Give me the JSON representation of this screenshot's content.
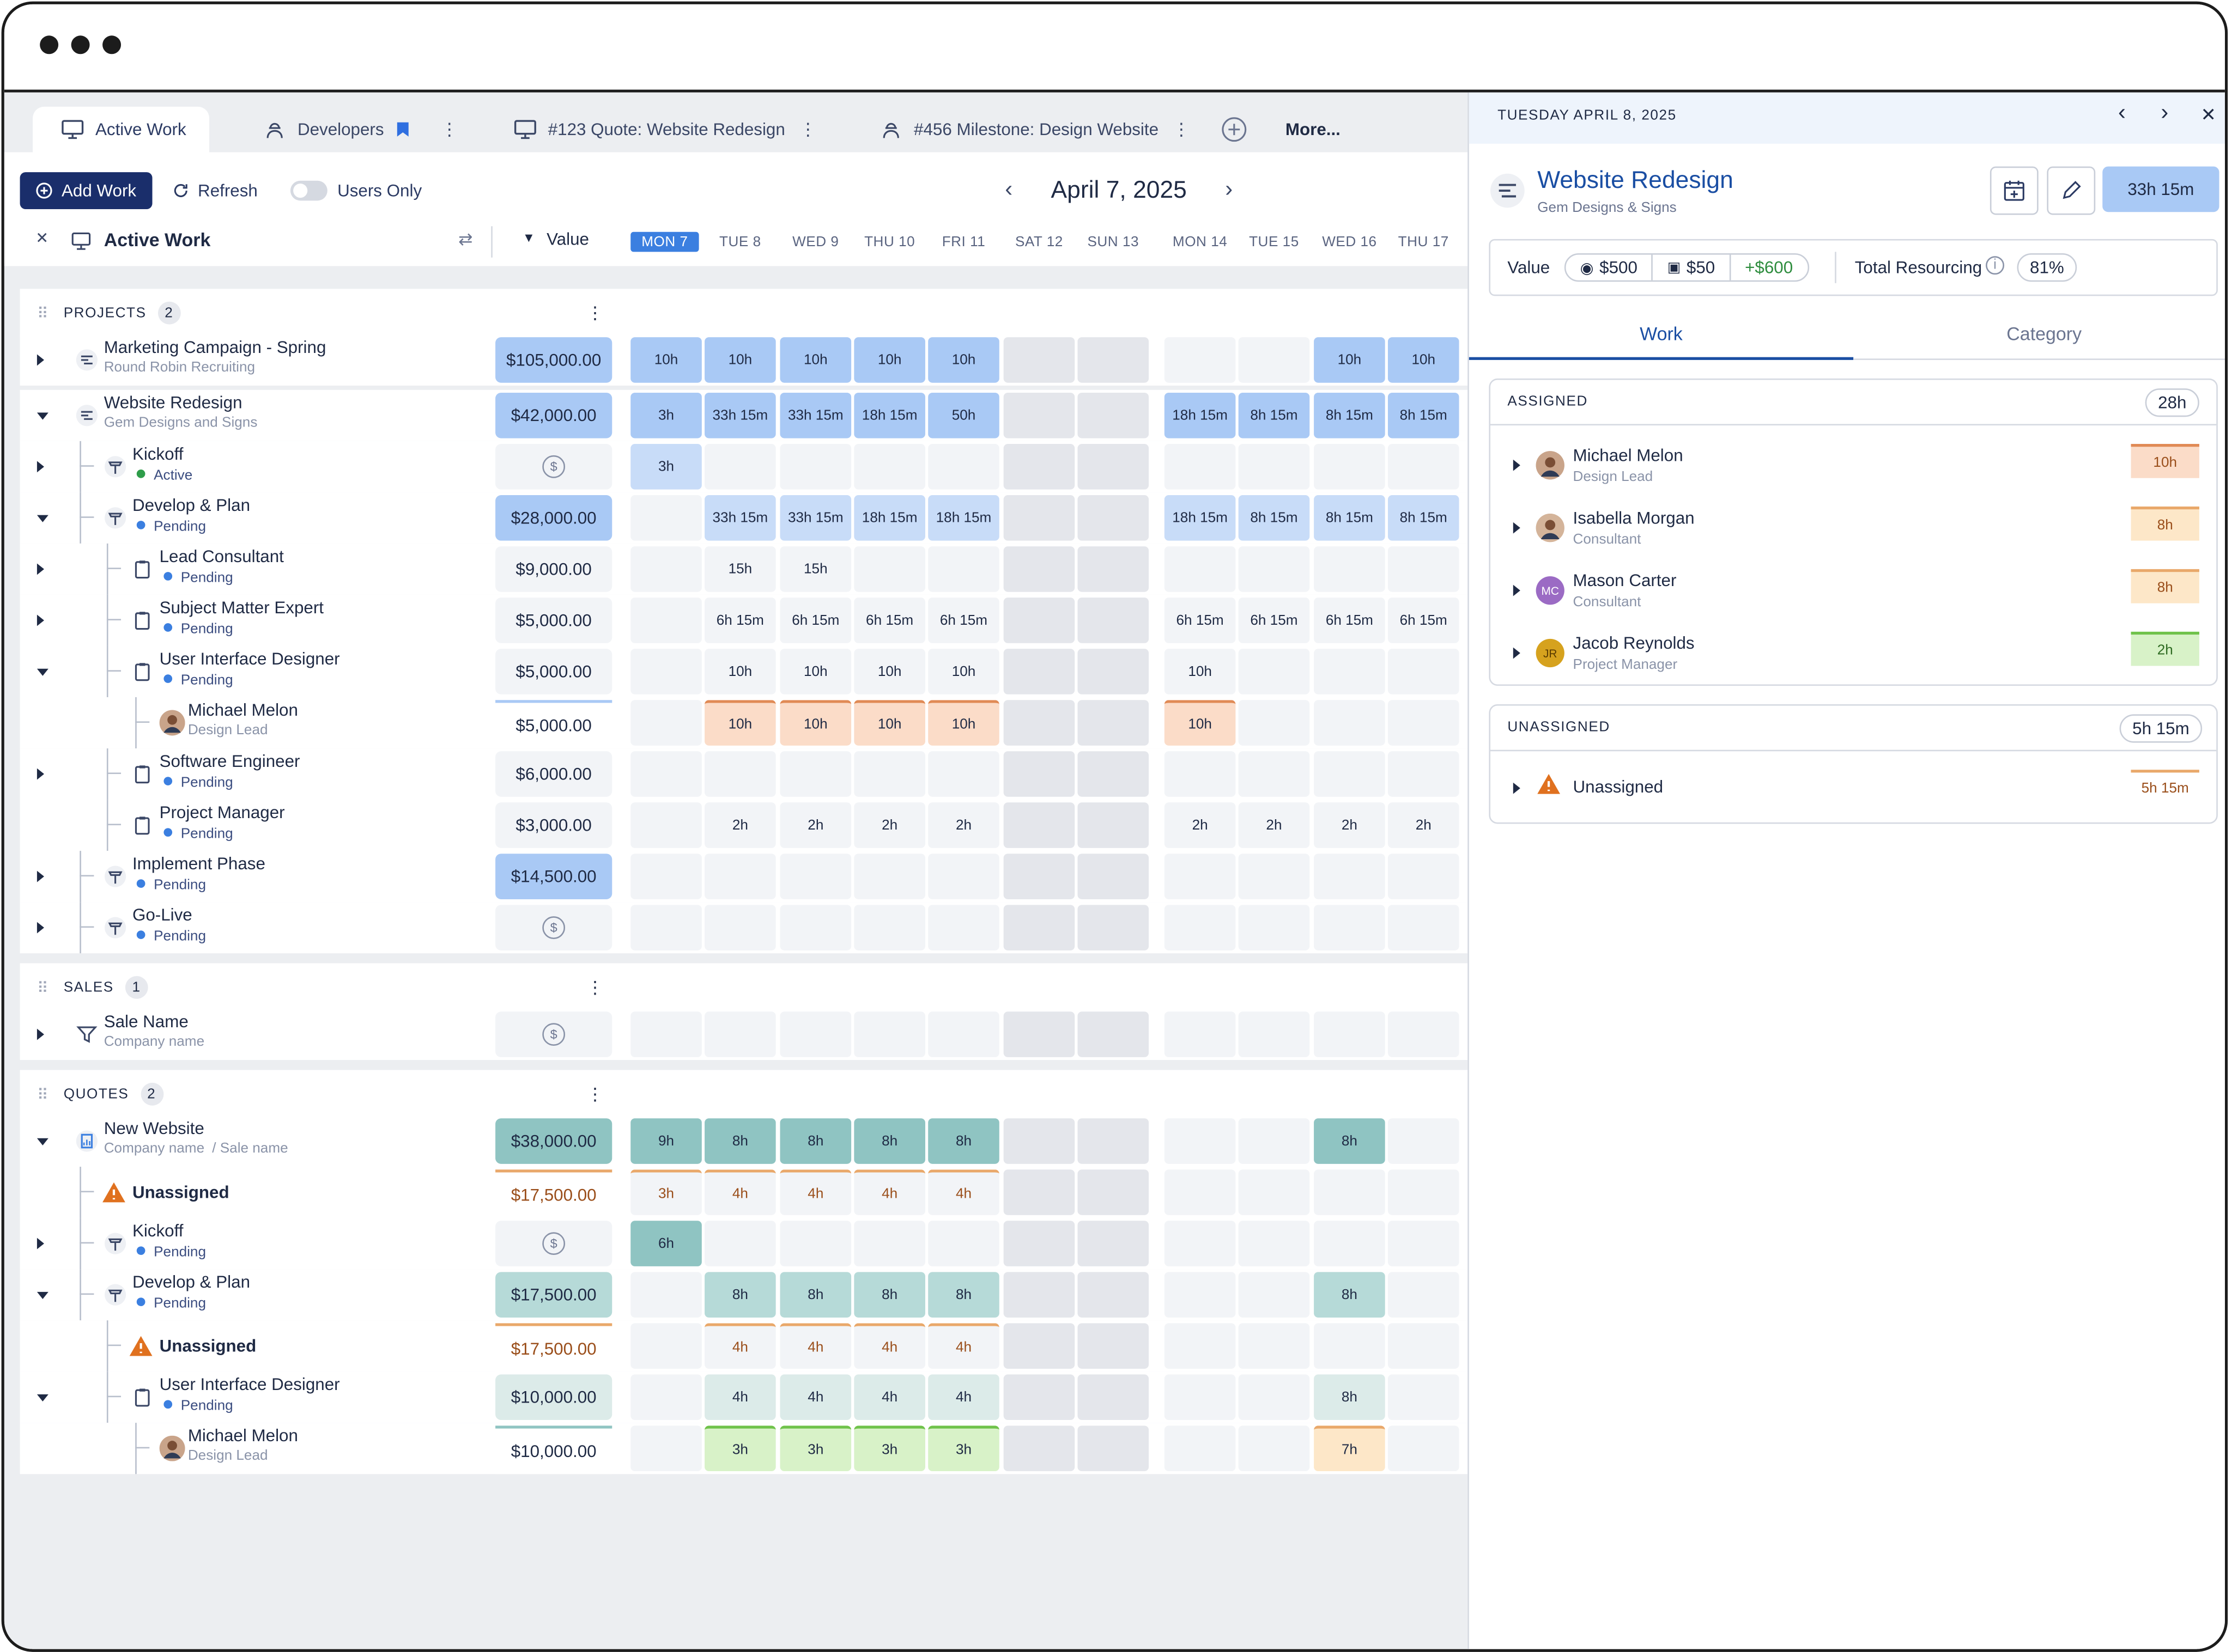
{
  "tabs": [
    {
      "label": "Active Work",
      "icon": "monitor-icon"
    },
    {
      "label": "Developers",
      "icon": "engineer-icon"
    },
    {
      "label": "#123 Quote: Website Redesign",
      "icon": "monitor-icon"
    },
    {
      "label": "#456 Milestone: Design Website",
      "icon": "engineer-icon"
    }
  ],
  "more_label": "More...",
  "toolbar": {
    "add_work": "Add Work",
    "refresh": "Refresh",
    "users_only": "Users Only",
    "date": "April 7, 2025"
  },
  "grid": {
    "title": "Active Work",
    "value_label": "Value",
    "days": [
      "MON 7",
      "TUE 8",
      "WED 9",
      "THU 10",
      "FRI 11",
      "SAT 12",
      "SUN 13",
      "MON 14",
      "TUE 15",
      "WED 16",
      "THU 17"
    ]
  },
  "sections": {
    "projects": "PROJECTS",
    "projects_count": "2",
    "sales": "SALES",
    "sales_count": "1",
    "quotes": "QUOTES",
    "quotes_count": "2"
  },
  "rows": [
    {
      "name": "Marketing Campaign - Spring",
      "sub": "Round Robin Recruiting",
      "value": "$105,000.00",
      "cells": [
        "10h",
        "10h",
        "10h",
        "10h",
        "10h",
        "",
        "",
        "",
        "",
        "10h",
        "10h"
      ]
    },
    {
      "name": "Website Redesign",
      "sub": "Gem Designs and Signs",
      "value": "$42,000.00",
      "cells": [
        "3h",
        "33h 15m",
        "33h 15m",
        "18h 15m",
        "50h",
        "",
        "",
        "18h 15m",
        "8h 15m",
        "8h 15m",
        "8h 15m"
      ]
    },
    {
      "name": "Kickoff",
      "status": "Active",
      "value": "",
      "cells": [
        "3h",
        "",
        "",
        "",
        "",
        "",
        "",
        "",
        "",
        "",
        ""
      ]
    },
    {
      "name": "Develop & Plan",
      "status": "Pending",
      "value": "$28,000.00",
      "cells": [
        "",
        "33h 15m",
        "33h 15m",
        "18h 15m",
        "18h 15m",
        "",
        "",
        "18h 15m",
        "8h 15m",
        "8h 15m",
        "8h 15m"
      ]
    },
    {
      "name": "Lead Consultant",
      "status": "Pending",
      "value": "$9,000.00",
      "cells": [
        "",
        "15h",
        "15h",
        "",
        "",
        "",
        "",
        "",
        "",
        "",
        ""
      ]
    },
    {
      "name": "Subject Matter Expert",
      "status": "Pending",
      "value": "$5,000.00",
      "cells": [
        "",
        "6h 15m",
        "6h 15m",
        "6h 15m",
        "6h 15m",
        "",
        "",
        "6h 15m",
        "6h 15m",
        "6h 15m",
        "6h 15m"
      ]
    },
    {
      "name": "User Interface Designer",
      "status": "Pending",
      "value": "$5,000.00",
      "cells": [
        "",
        "10h",
        "10h",
        "10h",
        "10h",
        "",
        "",
        "10h",
        "",
        "",
        ""
      ]
    },
    {
      "name": "Michael Melon",
      "sub": "Design Lead",
      "value": "$5,000.00",
      "cells": [
        "",
        "10h",
        "10h",
        "10h",
        "10h",
        "",
        "",
        "10h",
        "",
        "",
        ""
      ]
    },
    {
      "name": "Software Engineer",
      "status": "Pending",
      "value": "$6,000.00",
      "cells": [
        "",
        "",
        "",
        "",
        "",
        "",
        "",
        "",
        "",
        "",
        ""
      ]
    },
    {
      "name": "Project Manager",
      "status": "Pending",
      "value": "$3,000.00",
      "cells": [
        "",
        "2h",
        "2h",
        "2h",
        "2h",
        "",
        "",
        "2h",
        "2h",
        "2h",
        "2h"
      ]
    },
    {
      "name": "Implement Phase",
      "status": "Pending",
      "value": "$14,500.00",
      "cells": [
        "",
        "",
        "",
        "",
        "",
        "",
        "",
        "",
        "",
        "",
        ""
      ]
    },
    {
      "name": "Go-Live",
      "status": "Pending",
      "value": "",
      "cells": [
        "",
        "",
        "",
        "",
        "",
        "",
        "",
        "",
        "",
        "",
        ""
      ]
    },
    {
      "name": "Sale Name",
      "sub": "Company name",
      "value": "",
      "cells": [
        "",
        "",
        "",
        "",
        "",
        "",
        "",
        "",
        "",
        "",
        ""
      ]
    },
    {
      "name": "New Website",
      "sub": "Company name",
      "sub2": "Sale name",
      "value": "$38,000.00",
      "cells": [
        "9h",
        "8h",
        "8h",
        "8h",
        "8h",
        "",
        "",
        "",
        "",
        "8h",
        ""
      ]
    },
    {
      "name": "Unassigned",
      "value": "$17,500.00",
      "cells": [
        "3h",
        "4h",
        "4h",
        "4h",
        "4h",
        "",
        "",
        "",
        "",
        "",
        ""
      ]
    },
    {
      "name": "Kickoff",
      "status": "Pending",
      "value": "",
      "cells": [
        "6h",
        "",
        "",
        "",
        "",
        "",
        "",
        "",
        "",
        "",
        ""
      ]
    },
    {
      "name": "Develop & Plan",
      "status": "Pending",
      "value": "$17,500.00",
      "cells": [
        "",
        "8h",
        "8h",
        "8h",
        "8h",
        "",
        "",
        "",
        "",
        "8h",
        ""
      ]
    },
    {
      "name": "Unassigned",
      "value": "$17,500.00",
      "cells": [
        "",
        "4h",
        "4h",
        "4h",
        "4h",
        "",
        "",
        "",
        "",
        "",
        ""
      ]
    },
    {
      "name": "User Interface Designer",
      "status": "Pending",
      "value": "$10,000.00",
      "cells": [
        "",
        "4h",
        "4h",
        "4h",
        "4h",
        "",
        "",
        "",
        "",
        "8h",
        ""
      ]
    },
    {
      "name": "Michael Melon",
      "sub": "Design Lead",
      "value": "$10,000.00",
      "cells": [
        "",
        "3h",
        "3h",
        "3h",
        "3h",
        "",
        "",
        "",
        "",
        "7h",
        ""
      ]
    }
  ],
  "panel": {
    "date": "TUESDAY APRIL 8, 2025",
    "title": "Website Redesign",
    "subtitle": "Gem Designs & Signs",
    "total_hours": "33h 15m",
    "value_label": "Value",
    "value_views": "$500",
    "value_cost": "$50",
    "value_delta": "+$600",
    "resourcing_label": "Total Resourcing",
    "resourcing_pct": "81%",
    "tab_work": "Work",
    "tab_category": "Category",
    "assigned_label": "ASSIGNED",
    "assigned_total": "28h",
    "people": [
      {
        "name": "Michael Melon",
        "role": "Design Lead",
        "hours": "10h",
        "initials": ""
      },
      {
        "name": "Isabella Morgan",
        "role": "Consultant",
        "hours": "8h",
        "initials": ""
      },
      {
        "name": "Mason Carter",
        "role": "Consultant",
        "hours": "8h",
        "initials": "MC"
      },
      {
        "name": "Jacob Reynolds",
        "role": "Project Manager",
        "hours": "2h",
        "initials": "JR"
      }
    ],
    "unassigned_label": "UNASSIGNED",
    "unassigned_total": "5h 15m",
    "unassigned_name": "Unassigned",
    "unassigned_hours": "5h 15m"
  },
  "colors": {
    "primary": "#1a2e6b",
    "today": "#3b7fe0",
    "accent_blue": "#a9c9f5",
    "teal": "#8fc4c2",
    "warning": "#e0711f"
  }
}
